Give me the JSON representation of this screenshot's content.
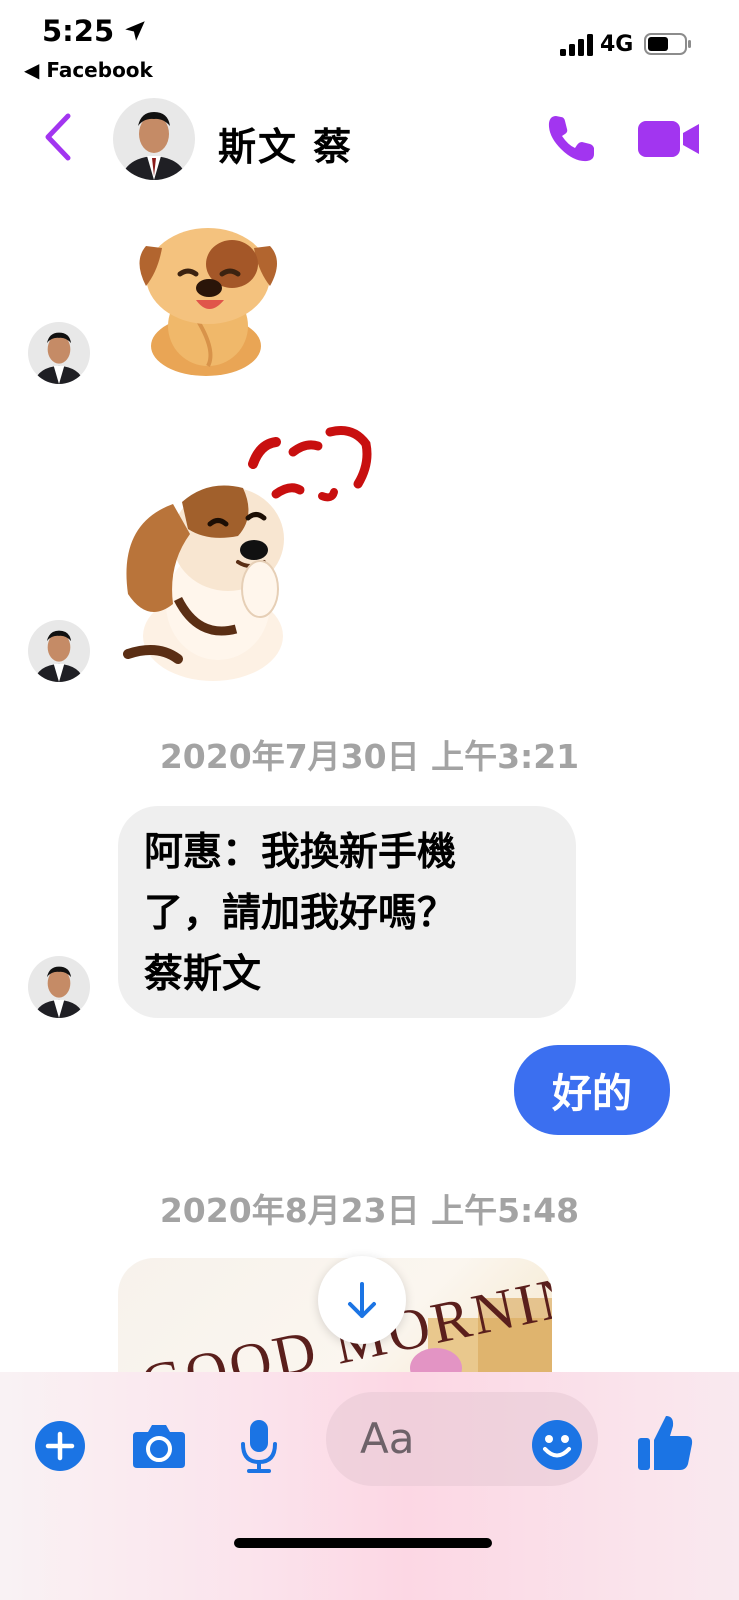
{
  "status_bar": {
    "time": "5:25",
    "back_app": "Facebook",
    "network": "4G"
  },
  "header": {
    "contact_name": "斯文 蔡"
  },
  "messages": {
    "timestamp_1": "2020年7月30日 上午3:21",
    "incoming_text": [
      "阿惠：我換新手機",
      "了，請加我好嗎？",
      "蔡斯文"
    ],
    "outgoing_text": "好的",
    "timestamp_2": "2020年8月23日 上午5:48",
    "image_caption": "GOOD MORNING"
  },
  "composer": {
    "placeholder": "Aa"
  },
  "colors": {
    "accent_purple": "#a235f0",
    "bubble_blue": "#3b6ff0",
    "icon_blue": "#1b74e4"
  },
  "icons": [
    "location-arrow-icon",
    "signal-icon",
    "battery-icon",
    "back-chevron-icon",
    "phone-icon",
    "video-icon",
    "dog-sticker",
    "beagle-sticker",
    "scroll-down-icon",
    "plus-icon",
    "camera-icon",
    "mic-icon",
    "emoji-icon",
    "thumbs-up-icon"
  ]
}
